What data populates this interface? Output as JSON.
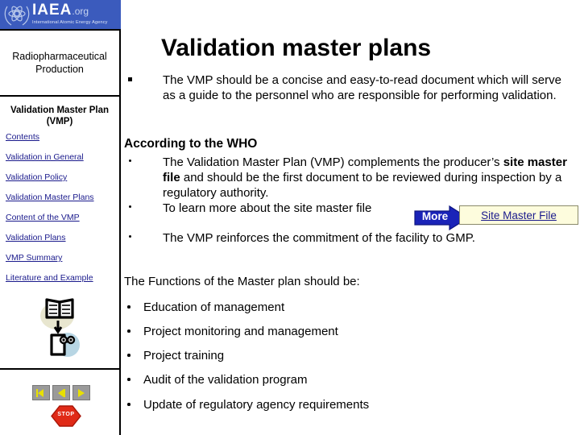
{
  "sidebar": {
    "logo": {
      "emblem_icon": "atom-laurel-icon",
      "name": "IAEA",
      "domain": ".org",
      "subtitle": "International Atomic Energy Agency",
      "banner_color": "#3b5bbd"
    },
    "department": "Radiopharmaceutical\nProduction",
    "department_line1": "Radiopharmaceutical",
    "department_line2": "Production",
    "section_line1": "Validation Master Plan",
    "section_line2": "(VMP)",
    "nav_links": [
      {
        "label": "Contents",
        "name": "sidebar-link-contents"
      },
      {
        "label": "Validation in General",
        "name": "sidebar-link-validation-in-general"
      },
      {
        "label": "Validation Policy",
        "name": "sidebar-link-validation-policy"
      },
      {
        "label": "Validation Master Plans",
        "name": "sidebar-link-validation-master-plans"
      },
      {
        "label": "Content of the VMP",
        "name": "sidebar-link-content-of-the-vmp"
      },
      {
        "label": "Validation Plans",
        "name": "sidebar-link-validation-plans"
      },
      {
        "label": "VMP Summary",
        "name": "sidebar-link-vmp-summary"
      },
      {
        "label": "Literature and Example",
        "name": "sidebar-link-literature-and-example"
      }
    ],
    "link_color": "#1a1a8c",
    "decoration_icon": "open-book-to-document-icon",
    "nav_buttons": [
      {
        "icon": "first-slide-icon"
      },
      {
        "icon": "previous-slide-icon"
      },
      {
        "icon": "next-slide-icon"
      }
    ],
    "stop_button": {
      "label": "STOP",
      "icon": "stop-octagon-icon",
      "color": "#e02a17"
    }
  },
  "main": {
    "title": "Validation master plans",
    "intro_bullet": "The VMP should be a concise and easy-to-read document which will serve as a guide to the personnel who are responsible for performing validation.",
    "who_heading": "According to the WHO",
    "who_items": [
      {
        "pre": "The Validation Master Plan (VMP) complements the producer’s ",
        "bold": "site master file",
        "post": " and should be the first document to be reviewed during inspection by a regulatory authority."
      },
      {
        "pre": "To learn more about the site master file",
        "bold": "",
        "post": ""
      },
      {
        "pre": "The VMP reinforces the commitment of the facility to GMP.",
        "bold": "",
        "post": ""
      }
    ],
    "more_arrow_label": "More",
    "site_master_file_button": "Site Master File",
    "functions_heading": "The Functions of the Master plan should be:",
    "functions": [
      "Education of management",
      "Project monitoring and management",
      "Project training",
      "Audit of the validation program",
      "Update of regulatory agency requirements"
    ]
  }
}
